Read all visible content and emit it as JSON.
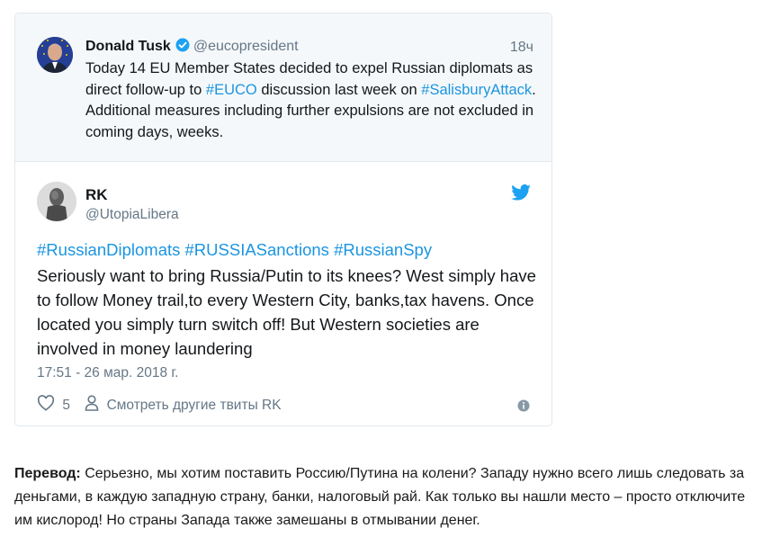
{
  "quoted_tweet": {
    "name": "Donald Tusk",
    "handle": "@eucopresident",
    "time": "18ч",
    "text_1": "Today 14 EU Member States decided to expel Russian diplomats as direct follow-up to ",
    "link_1": "#EUCO",
    "text_2": " discussion last week on ",
    "link_2": "#SalisburyAttack",
    "text_3": ". Additional measures including further expulsions are not excluded in coming days, weeks."
  },
  "tweet": {
    "name": "RK",
    "handle": "@UtopiaLibera",
    "hashtags": "#RussianDiplomats #RUSSIASanctions #RussianSpy",
    "text": "Seriously want to bring Russia/Putin to its knees? West simply have to follow Money trail,to every Western City, banks,tax havens. Once located you simply turn switch off! But Western societies are involved in money laundering",
    "date": "17:51 - 26 мар. 2018 г.",
    "like_count": "5",
    "more_tweets_label": "Смотреть другие твиты RK"
  },
  "translation": {
    "label": "Перевод:",
    "text": " Серьезно, мы хотим поставить Россию/Путина на колени? Западу нужно всего лишь следовать за деньгами, в каждую западную страну, банки, налоговый рай. Как только вы нашли место – просто отключите им кислород! Но страны Запада также замешаны в отмывании денег."
  },
  "colors": {
    "link": "#1b95e0",
    "muted": "#657786",
    "quoted_bg": "#f5f8fa",
    "border": "#e1e8ed"
  }
}
